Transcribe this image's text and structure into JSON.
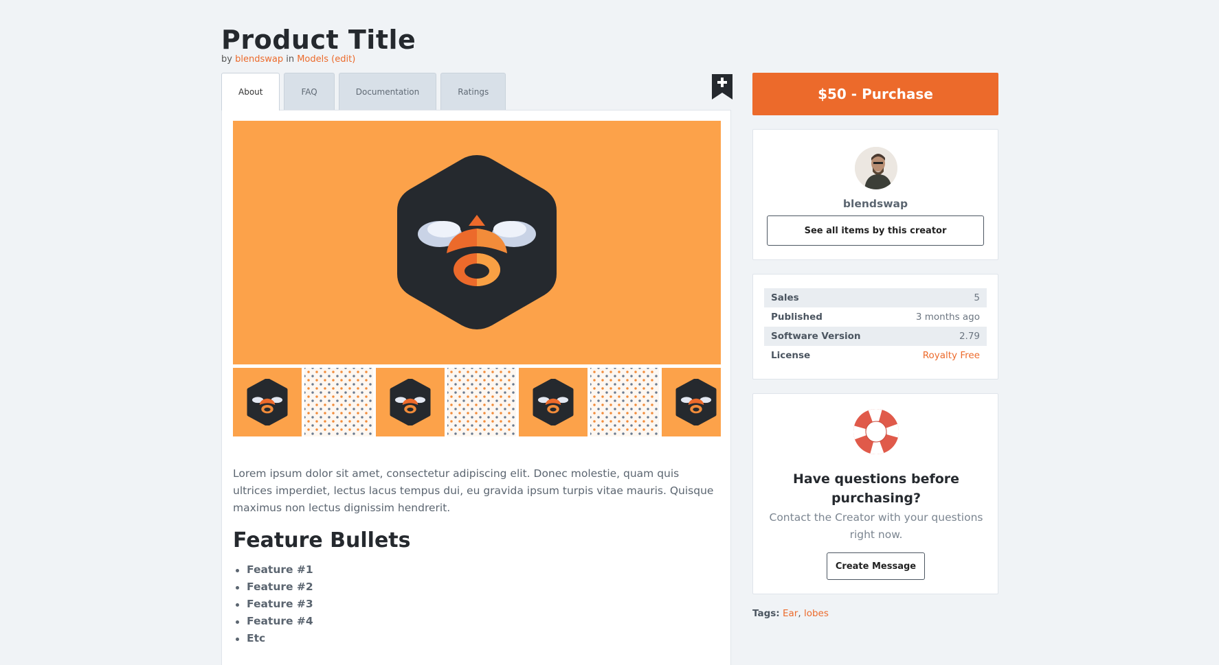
{
  "product": {
    "title": "Product Title",
    "by_prefix": "by",
    "creator": "blendswap",
    "in_word": "in",
    "category": "Models",
    "edit": "(edit)"
  },
  "tabs": [
    {
      "label": "About",
      "active": true
    },
    {
      "label": "FAQ",
      "active": false
    },
    {
      "label": "Documentation",
      "active": false
    },
    {
      "label": "Ratings",
      "active": false
    }
  ],
  "bookmark_icon": "bookmark-plus-icon",
  "gallery": {
    "thumbnails": [
      "logo",
      "pattern",
      "logo",
      "pattern",
      "logo",
      "pattern",
      "logo"
    ]
  },
  "description": "Lorem ipsum dolor sit amet, consectetur adipiscing elit. Donec molestie, quam quis ultrices imperdiet, lectus lacus tempus dui, eu gravida ipsum turpis vitae mauris. Quisque maximus non lectus dignissim hendrerit.",
  "features": {
    "title": "Feature Bullets",
    "items": [
      "Feature #1",
      "Feature #2",
      "Feature #3",
      "Feature #4",
      "Etc"
    ]
  },
  "sidebar": {
    "purchase_label": "$50 - Purchase",
    "creator_name": "blendswap",
    "see_all_label": "See all items by this creator",
    "stats": [
      {
        "label": "Sales",
        "value": "5"
      },
      {
        "label": "Published",
        "value": "3 months ago"
      },
      {
        "label": "Software Version",
        "value": "2.79"
      },
      {
        "label": "License",
        "value": "Royalty Free"
      }
    ],
    "help_title": "Have questions before purchasing?",
    "help_text": "Contact the Creator with your questions right now.",
    "create_message_label": "Create Message",
    "tags_label": "Tags:",
    "tags": [
      "Ear",
      "lobes"
    ]
  },
  "colors": {
    "accent": "#ec6a2b",
    "hero_bg": "#fca24a",
    "dark": "#25292e",
    "page_bg": "#f0f3f6"
  }
}
